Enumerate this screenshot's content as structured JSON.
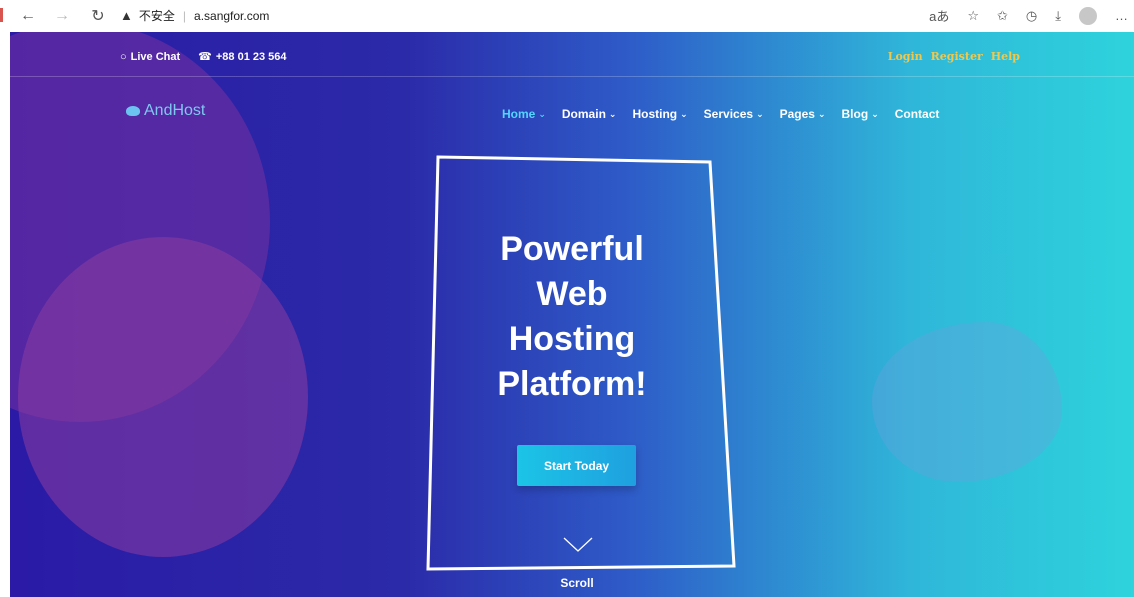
{
  "browser": {
    "security": "不安全",
    "url": "a.sangfor.com"
  },
  "topbar": {
    "live_chat": "Live Chat",
    "phone": "+88 01 23 564",
    "links": [
      "Login",
      "Register",
      "Help"
    ]
  },
  "logo": {
    "text": "AndHost"
  },
  "nav": {
    "items": [
      {
        "label": "Home",
        "dropdown": true,
        "active": true
      },
      {
        "label": "Domain",
        "dropdown": true,
        "active": false
      },
      {
        "label": "Hosting",
        "dropdown": true,
        "active": false
      },
      {
        "label": "Services",
        "dropdown": true,
        "active": false
      },
      {
        "label": "Pages",
        "dropdown": true,
        "active": false
      },
      {
        "label": "Blog",
        "dropdown": true,
        "active": false
      },
      {
        "label": "Contact",
        "dropdown": false,
        "active": false
      }
    ]
  },
  "hero": {
    "headline_lines": [
      "Powerful",
      "Web",
      "Hosting",
      "Platform!"
    ],
    "cta": "Start Today",
    "scroll": "Scroll"
  },
  "colors": {
    "gradient_start": "#2a1aa6",
    "gradient_end": "#2ed3dc",
    "active_nav": "#52d6ff",
    "toplinks": "#f0c84b"
  }
}
